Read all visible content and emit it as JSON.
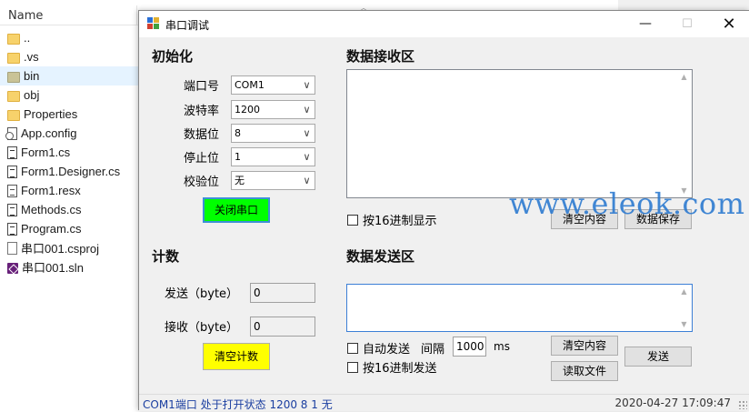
{
  "explorer": {
    "column_header": "Name",
    "files": [
      {
        "name": "..",
        "icon": "folder-icon"
      },
      {
        "name": ".vs",
        "icon": "folder-icon"
      },
      {
        "name": "bin",
        "icon": "folder-icon"
      },
      {
        "name": "obj",
        "icon": "folder-icon"
      },
      {
        "name": "Properties",
        "icon": "folder-icon"
      },
      {
        "name": "App.config",
        "icon": "config-file-icon"
      },
      {
        "name": "Form1.cs",
        "icon": "cs-file-icon"
      },
      {
        "name": "Form1.Designer.cs",
        "icon": "cs-file-icon"
      },
      {
        "name": "Form1.resx",
        "icon": "resx-file-icon"
      },
      {
        "name": "Methods.cs",
        "icon": "cs-file-icon"
      },
      {
        "name": "Program.cs",
        "icon": "cs-file-icon"
      },
      {
        "name": "串口001.csproj",
        "icon": "csproj-file-icon"
      },
      {
        "name": "串口001.sln",
        "icon": "sln-file-icon"
      }
    ]
  },
  "window": {
    "title": "串口调试",
    "minimize": "—",
    "maximize": "☐",
    "close": "✕"
  },
  "init": {
    "title": "初始化",
    "port_label": "端口号",
    "port_value": "COM1",
    "baud_label": "波特率",
    "baud_value": "1200",
    "databits_label": "数据位",
    "databits_value": "8",
    "stopbits_label": "停止位",
    "stopbits_value": "1",
    "parity_label": "校验位",
    "parity_value": "无",
    "toggle_button": "关闭串口"
  },
  "receive": {
    "title": "数据接收区",
    "hex_display_label": "按16进制显示",
    "clear_button": "清空内容",
    "save_button": "数据保存"
  },
  "count": {
    "title": "计数",
    "send_label": "发送（byte）",
    "send_value": "0",
    "recv_label": "接收（byte）",
    "recv_value": "0",
    "clear_button": "清空计数"
  },
  "send": {
    "title": "数据发送区",
    "auto_send_label": "自动发送",
    "interval_label": "间隔",
    "interval_value": "1000",
    "interval_unit": "ms",
    "hex_send_label": "按16进制发送",
    "clear_button": "清空内容",
    "read_file_button": "读取文件",
    "send_button": "发送"
  },
  "status": {
    "left": "COM1端口 处于打开状态 1200 8 1 无",
    "right": "2020-04-27 17:09:47"
  },
  "watermark": "www.eleok.com",
  "colors": {
    "open_button_bg": "#00ff00",
    "clear_count_bg": "#ffff00",
    "status_text": "#1a3ea0",
    "watermark": "#2e7bd0"
  }
}
